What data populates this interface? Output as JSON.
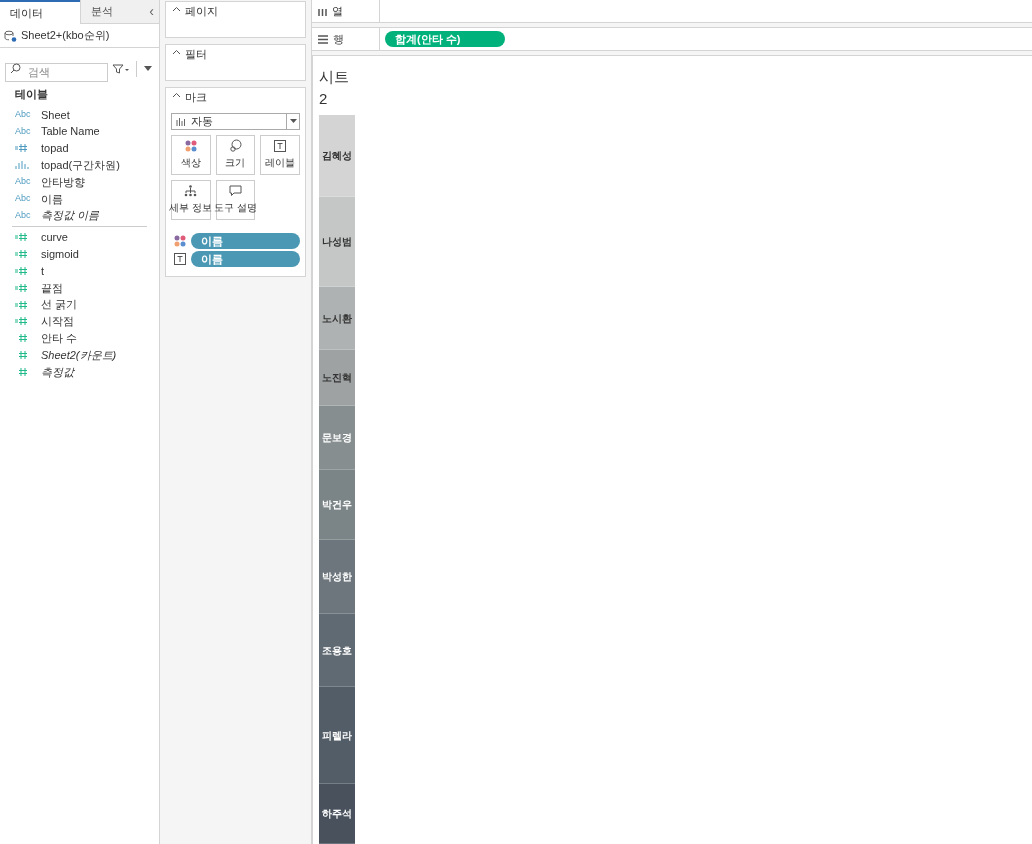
{
  "data_pane": {
    "tabs": [
      {
        "label": "데이터",
        "selected": true
      },
      {
        "label": "분석",
        "selected": false
      }
    ],
    "collapse": "‹",
    "source": "Sheet2+(kbo순위)",
    "search": {
      "placeholder": "검색"
    },
    "section": "테이블",
    "fields": [
      {
        "name": "Sheet",
        "kind": "string",
        "type_label": "Abc",
        "italic": false
      },
      {
        "name": "Table Name",
        "kind": "string",
        "type_label": "Abc",
        "italic": false
      },
      {
        "name": "topad",
        "kind": "calc_dim",
        "italic": false
      },
      {
        "name": "topad(구간차원)",
        "kind": "bin",
        "italic": false
      },
      {
        "name": "안타방향",
        "kind": "string",
        "type_label": "Abc",
        "italic": false
      },
      {
        "name": "이름",
        "kind": "string",
        "type_label": "Abc",
        "italic": false
      },
      {
        "name": "측정값 이름",
        "kind": "string",
        "type_label": "Abc",
        "italic": true
      }
    ],
    "measures": [
      {
        "name": "curve",
        "kind": "calc_measure",
        "italic": false
      },
      {
        "name": "sigmoid",
        "kind": "calc_measure",
        "italic": false
      },
      {
        "name": "t",
        "kind": "calc_measure",
        "italic": false
      },
      {
        "name": "끝점",
        "kind": "calc_measure",
        "italic": false
      },
      {
        "name": "선 굵기",
        "kind": "calc_measure",
        "italic": false
      },
      {
        "name": "시작점",
        "kind": "calc_measure",
        "italic": false
      },
      {
        "name": "안타 수",
        "kind": "measure",
        "italic": false
      },
      {
        "name": "Sheet2(카운트)",
        "kind": "measure",
        "italic": true
      },
      {
        "name": "측정값",
        "kind": "measure",
        "italic": true
      }
    ]
  },
  "cards": {
    "pages": "페이지",
    "filters": "필터",
    "marks": {
      "title": "마크",
      "mark_type": "자동",
      "buttons": [
        {
          "label": "색상",
          "kind": "color"
        },
        {
          "label": "크기",
          "kind": "size"
        },
        {
          "label": "레이블",
          "kind": "label"
        },
        {
          "label": "세부 정보",
          "kind": "detail"
        },
        {
          "label": "도구 설명",
          "kind": "tooltip"
        }
      ],
      "pills": [
        {
          "label": "이름",
          "kind": "color"
        },
        {
          "label": "이름",
          "kind": "label"
        }
      ]
    }
  },
  "shelves": {
    "columns": {
      "label": "열"
    },
    "rows": {
      "label": "행",
      "pill": "합계(안타 수)"
    }
  },
  "view": {
    "title": "시트\n2",
    "segments": [
      {
        "label": "김혜성",
        "color": "#d4d4d4"
      },
      {
        "label": "나성범",
        "color": "#c5c7c7"
      },
      {
        "label": "노시환",
        "color": "#aeb2b3"
      },
      {
        "label": "노진혁",
        "color": "#9ea2a3"
      },
      {
        "label": "문보경",
        "color": "#878e90"
      },
      {
        "label": "박건우",
        "color": "#7b8588"
      },
      {
        "label": "박성한",
        "color": "#6c767c"
      },
      {
        "label": "조용호",
        "color": "#606a72"
      },
      {
        "label": "피렐라",
        "color": "#535d67"
      },
      {
        "label": "하주석",
        "color": "#48515c"
      }
    ]
  }
}
